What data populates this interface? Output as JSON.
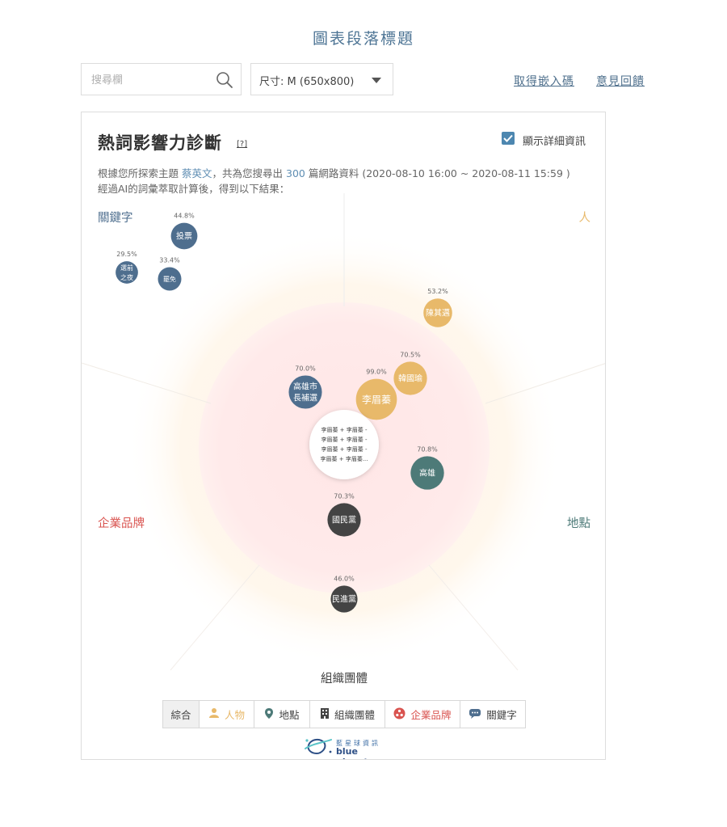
{
  "header": {
    "title": "圖表段落標題",
    "search_placeholder": "搜尋欄",
    "size_label": "尺寸: M (650x800)",
    "embed_link": "取得嵌入碼",
    "feedback_link": "意見回饋"
  },
  "widget": {
    "title": "熱詞影響力診斷",
    "help": "[?]",
    "detail_label": "顯示詳細資訊",
    "desc_prefix": "根據您所探索主題",
    "desc_topic": "蔡英文",
    "desc_mid": "，共為您搜尋出",
    "desc_count": "300",
    "desc_suffix": "篇網路資料 (2020-08-10 16:00 ~ 2020-08-11 15:59 )",
    "desc_line2": "經過AI的詞彙萃取計算後，得到以下結果："
  },
  "chart_data": {
    "type": "bubble-radar",
    "center_lines": [
      "李眉蓁 + 李眉蓁 -",
      "李眉蓁 + 李眉蓁 -",
      "李眉蓁 + 李眉蓁 -",
      "李眉蓁 + 李眉蓁..."
    ],
    "categories": [
      {
        "key": "keyword",
        "label": "關鍵字",
        "color": "#4e6e8e"
      },
      {
        "key": "person",
        "label": "人",
        "color": "#e8b96a"
      },
      {
        "key": "brand",
        "label": "企業品牌",
        "color": "#d9534f"
      },
      {
        "key": "place",
        "label": "地點",
        "color": "#4d7a78"
      },
      {
        "key": "org",
        "label": "組織團體",
        "color": "#444444"
      }
    ],
    "bubbles": [
      {
        "lines": [
          "投票"
        ],
        "pct": "44.8%",
        "category": "keyword",
        "value": 44.8
      },
      {
        "lines": [
          "選前",
          "之夜"
        ],
        "pct": "29.5%",
        "category": "keyword",
        "value": 29.5
      },
      {
        "lines": [
          "罷免"
        ],
        "pct": "33.4%",
        "category": "keyword",
        "value": 33.4
      },
      {
        "lines": [
          "陳其邁"
        ],
        "pct": "53.2%",
        "category": "person",
        "value": 53.2
      },
      {
        "lines": [
          "韓國瑜"
        ],
        "pct": "70.5%",
        "category": "person",
        "value": 70.5
      },
      {
        "lines": [
          "李眉蓁"
        ],
        "pct": "99.0%",
        "category": "person",
        "value": 99.0
      },
      {
        "lines": [
          "高雄市",
          "長補選"
        ],
        "pct": "70.0%",
        "category": "keyword",
        "value": 70.0
      },
      {
        "lines": [
          "高雄"
        ],
        "pct": "70.8%",
        "category": "place",
        "value": 70.8
      },
      {
        "lines": [
          "國民黨"
        ],
        "pct": "70.3%",
        "category": "org",
        "value": 70.3
      },
      {
        "lines": [
          "民進黨"
        ],
        "pct": "46.0%",
        "category": "org",
        "value": 46.0
      }
    ]
  },
  "tabs": [
    {
      "label": "綜合",
      "icon": "none",
      "color": "#444444"
    },
    {
      "label": "人物",
      "icon": "person-icon",
      "color": "#e8b96a"
    },
    {
      "label": "地點",
      "icon": "map-pin-icon",
      "color": "#4d7a78"
    },
    {
      "label": "組織團體",
      "icon": "building-icon",
      "color": "#444444"
    },
    {
      "label": "企業品牌",
      "icon": "brand-icon",
      "color": "#d9534f"
    },
    {
      "label": "關鍵字",
      "icon": "chat-icon",
      "color": "#4e6e8e"
    }
  ],
  "logo": {
    "zh": "藍星球資訊",
    "en": "blue planet"
  }
}
